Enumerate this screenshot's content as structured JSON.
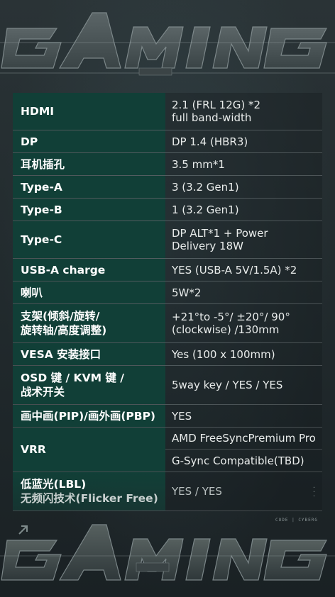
{
  "header": {
    "brand_word": "GAMING"
  },
  "footer": {
    "brand_word": "GAMING",
    "badge": "CODE | CYBERG",
    "side_text": ""
  },
  "specs": [
    {
      "label": "HDMI",
      "value": [
        "2.1 (FRL 12G) *2",
        "full band-width"
      ]
    },
    {
      "label": "DP",
      "value": [
        "DP 1.4 (HBR3)"
      ]
    },
    {
      "label": "耳机插孔",
      "value": [
        "3.5 mm*1"
      ]
    },
    {
      "label": "Type-A",
      "value": [
        "3 (3.2 Gen1)"
      ]
    },
    {
      "label": "Type-B",
      "value": [
        "1 (3.2 Gen1)"
      ]
    },
    {
      "label": "Type-C",
      "value": [
        "DP ALT*1 + Power",
        "Delivery 18W"
      ]
    },
    {
      "label": "USB-A charge",
      "value": [
        "YES (USB-A 5V/1.5A) *2"
      ]
    },
    {
      "label": "喇叭",
      "value": [
        "5W*2"
      ]
    },
    {
      "label_lines": [
        "支架(倾斜/旋转/",
        "旋转轴/高度调整)"
      ],
      "value": [
        "+21°to -5°/ ±20°/ 90°",
        "(clockwise) /130mm"
      ]
    },
    {
      "label": "VESA 安装接口",
      "value": [
        "Yes (100 x 100mm)"
      ]
    },
    {
      "label_lines": [
        "OSD 键 / KVM 键 /",
        "战术开关"
      ],
      "value": [
        "5way key / YES / YES"
      ]
    },
    {
      "label": "画中画(PIP)/画外画(PBP)",
      "value": [
        "YES"
      ]
    },
    {
      "label": "VRR",
      "value": [
        "AMD FreeSyncPremium Pro",
        "G-Sync Compatible(TBD)"
      ]
    },
    {
      "label_lines": [
        "低蓝光(LBL)",
        "无频闪技术(Flicker Free)"
      ],
      "value": [
        "YES / YES"
      ]
    }
  ]
}
